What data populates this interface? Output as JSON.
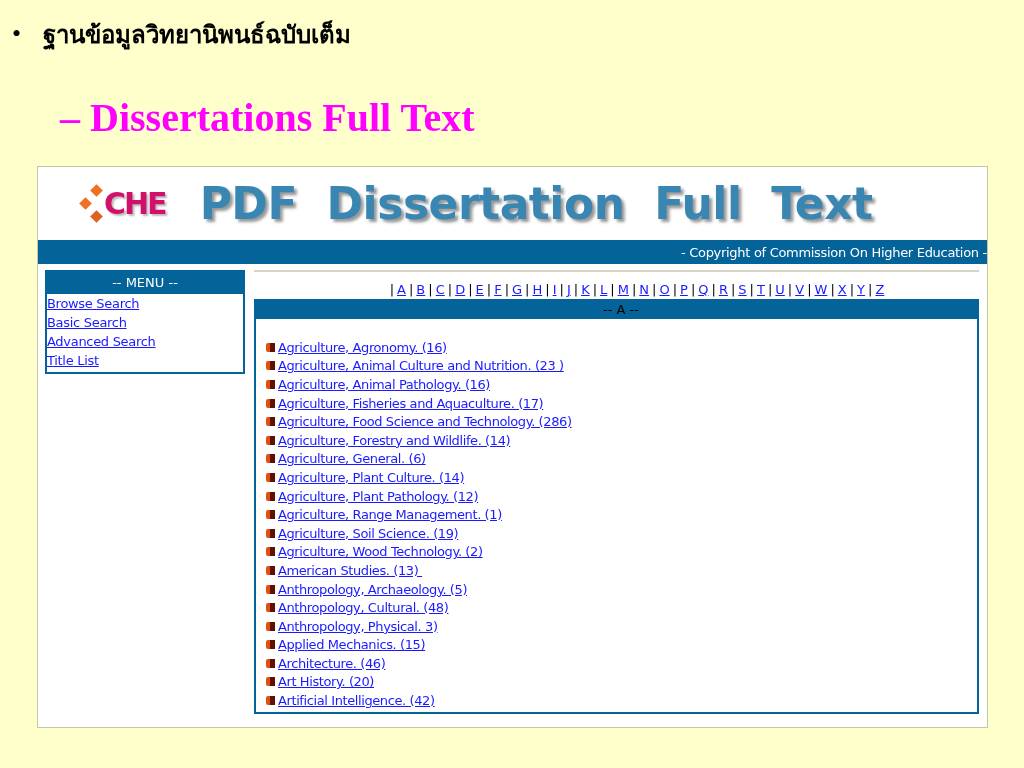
{
  "slide": {
    "bullet": "•",
    "heading": "ฐานข้อมูลวิทยานิพนธ์ฉบับเต็ม",
    "subheading": "– Dissertations Full Text"
  },
  "site": {
    "logo_text": "CHE",
    "title": "PDF  Dissertation  Full  Text",
    "copyright": "- Copyright of Commission On Higher Education -",
    "menu": {
      "title": "-- MENU --",
      "items": [
        "Browse Search",
        "Basic Search",
        "Advanced Search",
        "Title List"
      ]
    },
    "letter_separator": "|",
    "letters": [
      "A",
      "B",
      "C",
      "D",
      "E",
      "F",
      "G",
      "H",
      "I",
      "J",
      "K",
      "L",
      "M",
      "N",
      "O",
      "P",
      "Q",
      "R",
      "S",
      "T",
      "U",
      "V",
      "W",
      "X",
      "Y",
      "Z"
    ],
    "section_title": "-- A --",
    "subjects": [
      "Agriculture, Agronomy. (16)",
      "Agriculture, Animal Culture and Nutrition. (23 )",
      "Agriculture, Animal Pathology. (16)",
      "Agriculture, Fisheries and Aquaculture. (17)",
      "Agriculture, Food Science and Technology. (286)",
      "Agriculture, Forestry and Wildlife. (14)",
      "Agriculture, General. (6)",
      "Agriculture, Plant Culture. (14)",
      "Agriculture, Plant Pathology. (12)",
      "Agriculture, Range Management. (1)",
      "Agriculture, Soil Science. (19)",
      "Agriculture, Wood Technology. (2)",
      "American Studies. (13) ",
      "Anthropology, Archaeology. (5)",
      "Anthropology, Cultural. (48)",
      "Anthropology, Physical. 3)",
      "Applied Mechanics. (15)",
      "Architecture. (46)",
      "Art History. (20)",
      "Artificial Intelligence. (42)"
    ]
  }
}
